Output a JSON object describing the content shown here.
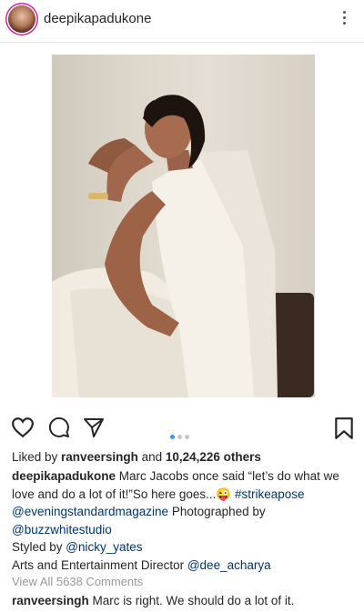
{
  "header": {
    "username": "deepikapadukone"
  },
  "post": {
    "carousel": {
      "count": 3,
      "active_index": 0
    }
  },
  "likes": {
    "prefix": "Liked by ",
    "user": "ranveersingh",
    "middle": " and ",
    "count": "10,24,226 others"
  },
  "caption": {
    "author": "deepikapadukone",
    "text1": " Marc Jacobs once said “let’s do what we love and do a lot of it!”So here goes...😜 ",
    "hashtag": "#strikeapose",
    "mention1": "@eveningstandardmagazine",
    "text2": " Photographed by ",
    "mention2": "@buzzwhitestudio",
    "text3": "Styled by ",
    "mention3": "@nicky_yates",
    "text4": "Arts and Entertainment Director ",
    "mention4": "@dee_acharya"
  },
  "comments_link": "View All 5638 Comments",
  "top_comment": {
    "user": "ranveersingh",
    "text": " Marc is right. We should do a lot of it."
  },
  "icons": [
    "heart-icon",
    "comment-icon",
    "share-icon",
    "bookmark-icon",
    "more-icon"
  ],
  "colors": {
    "link": "#003569",
    "dot_active": "#3897f0",
    "muted": "#999999"
  }
}
